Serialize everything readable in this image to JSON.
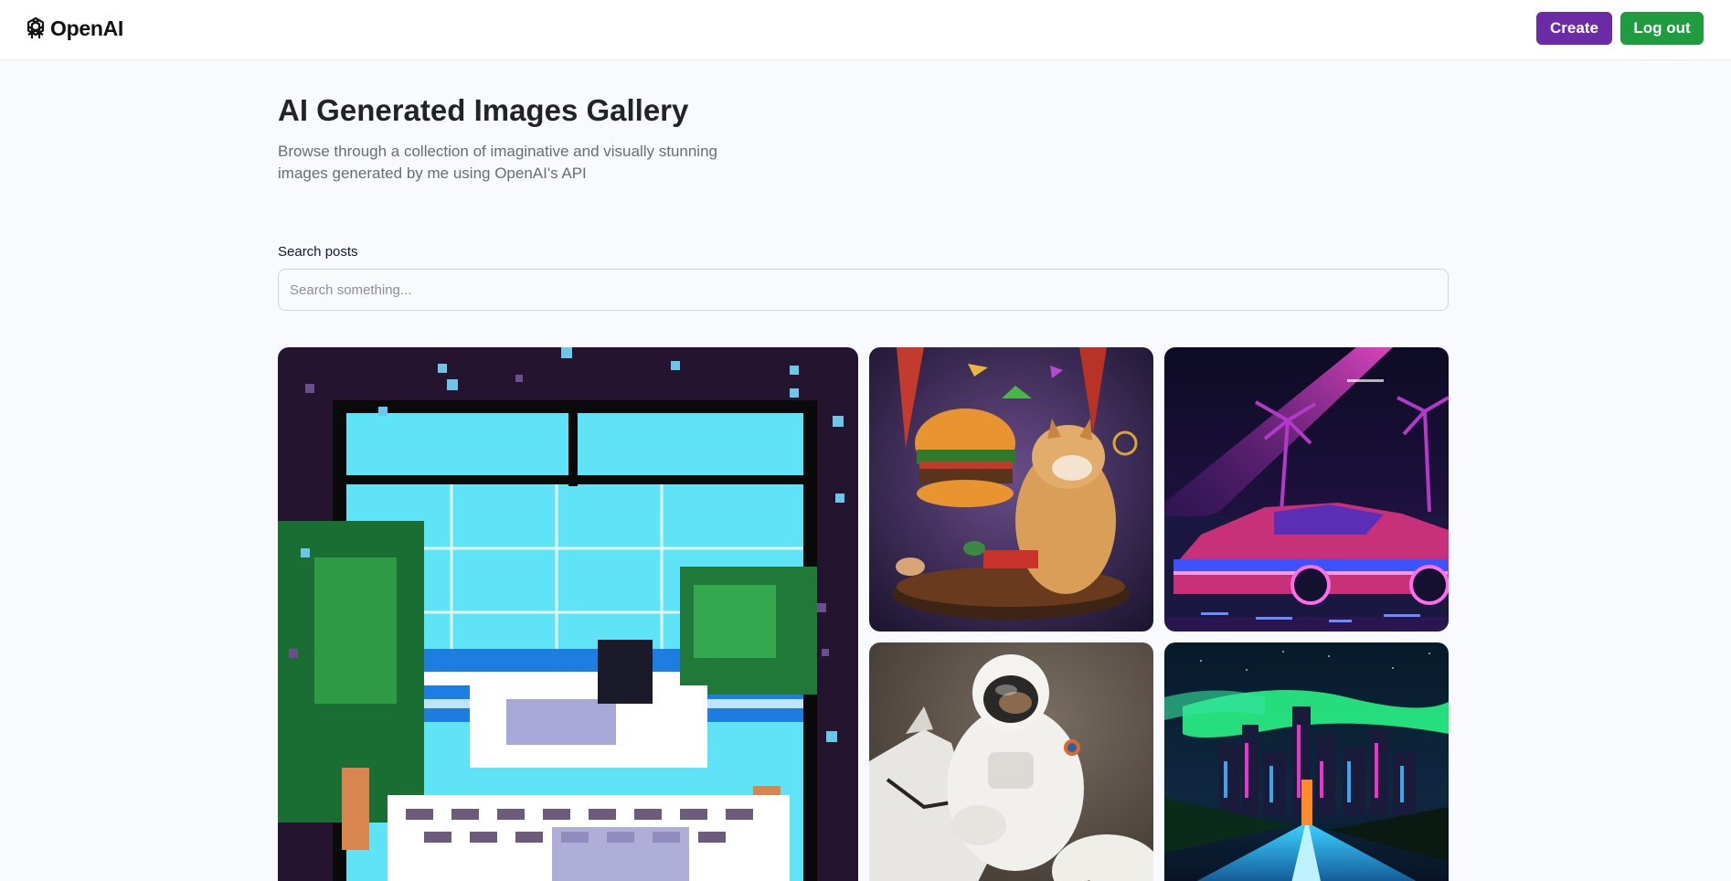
{
  "header": {
    "logo_text": "OpenAI",
    "create_label": "Create",
    "logout_label": "Log out",
    "create_color": "#6b2aa6",
    "logout_color": "#1e9c3f"
  },
  "hero": {
    "title": "AI Generated Images Gallery",
    "subtitle": "Browse through a collection of imaginative and visually stunning images generated by me using OpenAI's API"
  },
  "search": {
    "label": "Search posts",
    "placeholder": "Search something...",
    "value": ""
  },
  "gallery": {
    "items": [
      {
        "icon": "pixel-art-room-image"
      },
      {
        "icon": "dog-burger-image"
      },
      {
        "icon": "synthwave-car-image"
      },
      {
        "icon": "astronaut-horse-image"
      },
      {
        "icon": "neon-city-road-image"
      }
    ]
  }
}
